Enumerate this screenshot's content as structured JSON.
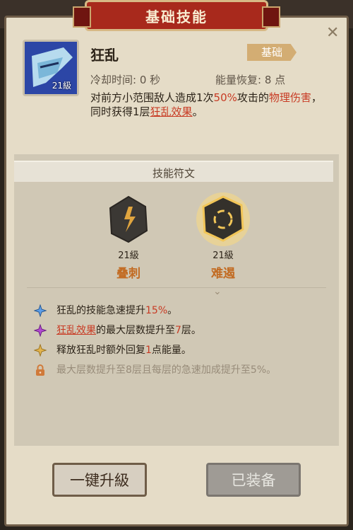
{
  "header": {
    "title": "基础技能"
  },
  "skill": {
    "name": "狂乱",
    "type_badge": "基础",
    "icon_level": "21級",
    "cooldown": "冷却时间: 0 秒",
    "energy": "能量恢复: 8 点",
    "desc": {
      "part1": "对前方小范围敌人造成1次",
      "percent": "50%",
      "part2": "攻击的",
      "physical": "物理伤害",
      "part3": "，同时获得1层",
      "effect_link": "狂乱效果",
      "part4": "。"
    }
  },
  "runes": {
    "section_title": "技能符文",
    "items": [
      {
        "level": "21級",
        "name": "叠刺"
      },
      {
        "level": "21級",
        "name": "难遏"
      }
    ]
  },
  "effects": [
    {
      "text_a": "狂乱的技能急速提升",
      "value": "15%",
      "text_b": "。",
      "icon": "blue-star-icon",
      "color": "#5c9ee8"
    },
    {
      "link": "狂乱效果",
      "text_a": "的最大层数提升至",
      "value": "7",
      "text_b": "层。",
      "icon": "purple-star-icon",
      "color": "#b24ad1"
    },
    {
      "text_a": "释放狂乱时额外回复",
      "value": "1",
      "text_b": "点能量。",
      "icon": "gold-star-icon",
      "color": "#e3b44d"
    },
    {
      "text_locked": "最大层数提升至8层且每层的急速加成提升至5%。",
      "icon": "lock-icon"
    }
  ],
  "buttons": {
    "upgrade": "一键升級",
    "equipped": "已装备"
  },
  "colors": {
    "accent_red": "#c83b24",
    "rune_gold": "#c26b22",
    "banner": "#a8291c"
  }
}
